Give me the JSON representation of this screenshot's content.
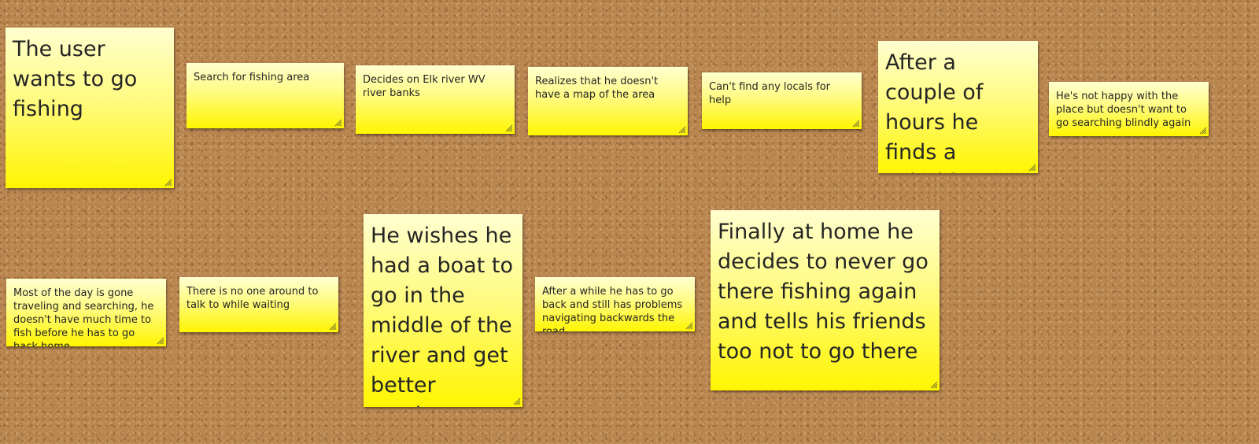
{
  "board": {
    "notes": [
      {
        "id": "n1",
        "text": "The user wants to go fishing"
      },
      {
        "id": "n2",
        "text": "Search for fishing area"
      },
      {
        "id": "n3",
        "text": "Decides on Elk river WV river banks"
      },
      {
        "id": "n4",
        "text": "Realizes that he doesn't have a map of the area"
      },
      {
        "id": "n5",
        "text": "Can't find any locals for help"
      },
      {
        "id": "n6",
        "text": "After a couple of hours he finds a suitable spot"
      },
      {
        "id": "n7",
        "text": "He's not happy with the place but doesn't want to go searching blindly again"
      },
      {
        "id": "n8",
        "text": "Most of the day is gone traveling and searching, he doesn't have much time to fish before he has to go back home"
      },
      {
        "id": "n9",
        "text": "There is no one around to talk to while waiting"
      },
      {
        "id": "n10",
        "text": "He wishes he had a boat to go in the middle of the river and get better catches"
      },
      {
        "id": "n11",
        "text": "After a while he has to go back and still has problems navigating backwards the road"
      },
      {
        "id": "n12",
        "text": "Finally at home he decides to never go there fishing again and tells his friends too not to go there"
      }
    ]
  },
  "icons": {
    "resize_handle": "resize-grip-icon"
  },
  "colors": {
    "note_top": "#ffffd0",
    "note_bottom": "#fff500",
    "cork": "#b98650"
  }
}
